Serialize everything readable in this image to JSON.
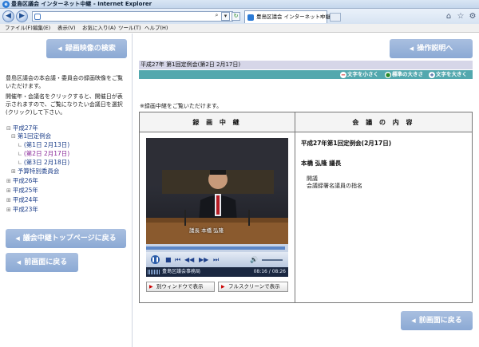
{
  "window": {
    "title": "豊島区議会 インターネット中継 - Internet Explorer"
  },
  "tab": {
    "label": "豊島区議会 インターネット中継"
  },
  "menu": [
    "ファイル(F)",
    "編集(E)",
    "表示(V)",
    "お気に入り(A)",
    "ツール(T)",
    "ヘルプ(H)"
  ],
  "left": {
    "search_button": "録画映像の検索",
    "intro": "豊島区議会の本会議・委員会の録画映像をご覧いただけます。",
    "instructions": "開催年・会議名をクリックすると、開催日が表示されますので、ご覧になりたい会議日を選択(クリック)して下さい。",
    "tree": [
      {
        "mark": "⊟",
        "label": "平成27年"
      },
      {
        "mark": "⊟",
        "label": "第1回定例会"
      },
      {
        "mark": "∟",
        "label": "(第1日 2月13日)"
      },
      {
        "mark": "∟",
        "label": "(第2日 2月17日)"
      },
      {
        "mark": "∟",
        "label": "(第3日 2月18日)"
      },
      {
        "mark": "⊞",
        "label": "予算特別委員会"
      },
      {
        "mark": "⊞",
        "label": "平成26年"
      },
      {
        "mark": "⊞",
        "label": "平成25年"
      },
      {
        "mark": "⊞",
        "label": "平成24年"
      },
      {
        "mark": "⊞",
        "label": "平成23年"
      }
    ],
    "top_button": "議会中継トップページに戻る",
    "back_button": "前画面に戻る"
  },
  "right": {
    "manual_button": "操作説明へ",
    "session_title": "平成27年 第1回定例会(第2日 2月17日)",
    "font_small": "文字を小さく",
    "font_normal": "標準の大きさ",
    "font_large": "文字を大きく",
    "note": "※録画中継をご覧いただけます。",
    "col_recording": "録 画 中 継",
    "col_content": "会 議 の 内 容",
    "player_status_left": "豊島区議会事務局",
    "player_time": "08:16 / 08:26",
    "video_caption": "議長 本橋 弘隆",
    "new_window_button": "別ウィンドウで表示",
    "fullscreen_button": "フルスクリーンで表示",
    "content_title": "平成27年第1回定例会(2月17日)",
    "speaker": "本橋 弘隆 議長",
    "agenda_items": [
      "開議",
      "会議録署名議員の指名"
    ],
    "back_button": "前画面に戻る"
  },
  "colors": {
    "accent_blue": "#8ba9d4",
    "teal": "#53a8ae",
    "session_bar": "#d6d6e8"
  },
  "playback_progress": 0.98
}
